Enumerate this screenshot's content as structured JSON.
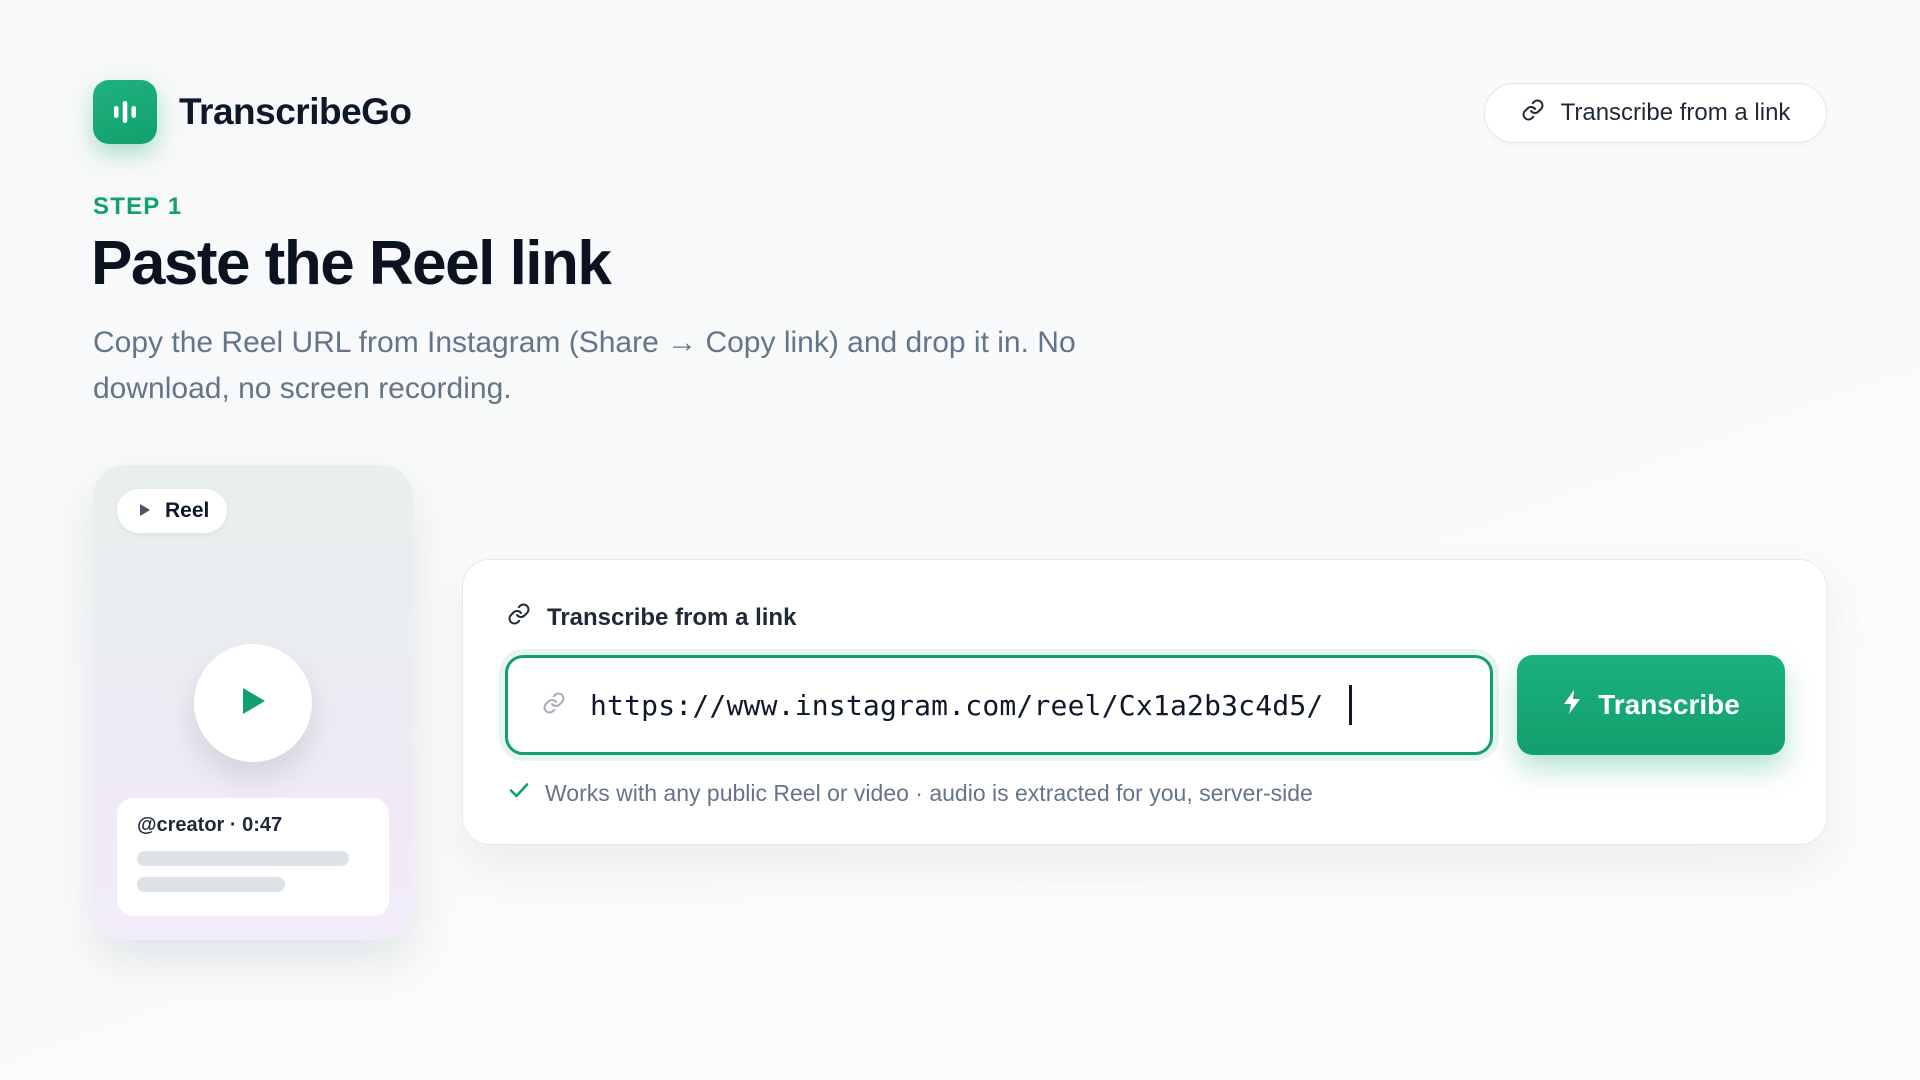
{
  "header": {
    "brand_name": "TranscribeGo",
    "logo_icon": "audio-bars-icon",
    "top_link_label": "Transcribe from a link"
  },
  "hero": {
    "step_label": "STEP 1",
    "title": "Paste the Reel link",
    "subtitle": "Copy the Reel URL from Instagram (Share → Copy link) and drop it in. No download, no screen recording."
  },
  "phone_preview": {
    "badge_label": "Reel",
    "meta_text": "@creator · 0:47"
  },
  "link_card": {
    "label": "Transcribe from a link",
    "input_value": "https://www.instagram.com/reel/Cx1a2b3c4d5/",
    "button_label": "Transcribe",
    "hint": "Works with any public Reel or video · audio is extracted for you, server-side"
  },
  "colors": {
    "accent": "#12a06d",
    "text_primary": "#0f172a",
    "text_muted": "#64748b"
  }
}
